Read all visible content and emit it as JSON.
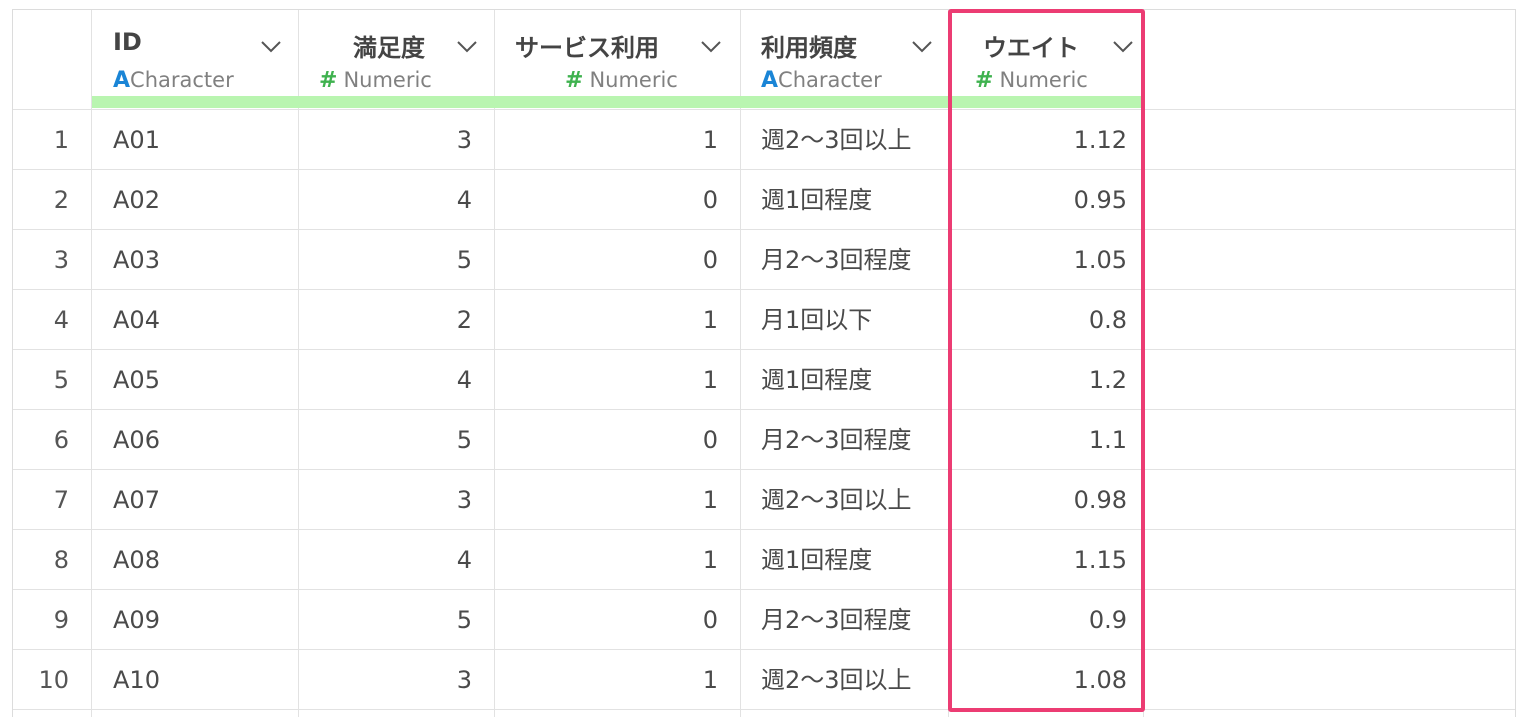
{
  "columns": [
    {
      "name": "ID",
      "type": "Character",
      "type_icon": "A"
    },
    {
      "name": "満足度",
      "type": "Numeric",
      "type_icon": "#"
    },
    {
      "name": "サービス利用",
      "type": "Numeric",
      "type_icon": "#"
    },
    {
      "name": "利用頻度",
      "type": "Character",
      "type_icon": "A"
    },
    {
      "name": "ウエイト",
      "type": "Numeric",
      "type_icon": "#"
    }
  ],
  "rows": [
    {
      "n": "1",
      "id": "A01",
      "satisfaction": "3",
      "usage": "1",
      "freq": "週2〜3回以上",
      "weight": "1.12"
    },
    {
      "n": "2",
      "id": "A02",
      "satisfaction": "4",
      "usage": "0",
      "freq": "週1回程度",
      "weight": "0.95"
    },
    {
      "n": "3",
      "id": "A03",
      "satisfaction": "5",
      "usage": "0",
      "freq": "月2〜3回程度",
      "weight": "1.05"
    },
    {
      "n": "4",
      "id": "A04",
      "satisfaction": "2",
      "usage": "1",
      "freq": "月1回以下",
      "weight": "0.8"
    },
    {
      "n": "5",
      "id": "A05",
      "satisfaction": "4",
      "usage": "1",
      "freq": "週1回程度",
      "weight": "1.2"
    },
    {
      "n": "6",
      "id": "A06",
      "satisfaction": "5",
      "usage": "0",
      "freq": "月2〜3回程度",
      "weight": "1.1"
    },
    {
      "n": "7",
      "id": "A07",
      "satisfaction": "3",
      "usage": "1",
      "freq": "週2〜3回以上",
      "weight": "0.98"
    },
    {
      "n": "8",
      "id": "A08",
      "satisfaction": "4",
      "usage": "1",
      "freq": "週1回程度",
      "weight": "1.15"
    },
    {
      "n": "9",
      "id": "A09",
      "satisfaction": "5",
      "usage": "0",
      "freq": "月2〜3回程度",
      "weight": "0.9"
    },
    {
      "n": "10",
      "id": "A10",
      "satisfaction": "3",
      "usage": "1",
      "freq": "週2〜3回以上",
      "weight": "1.08"
    }
  ],
  "colors": {
    "highlight": "#ec3c73",
    "header_bar": "#b9f5b0",
    "character_icon": "#1a85d6",
    "numeric_icon": "#3fb24f"
  },
  "icons": {
    "dropdown": "chevron-down-icon"
  }
}
